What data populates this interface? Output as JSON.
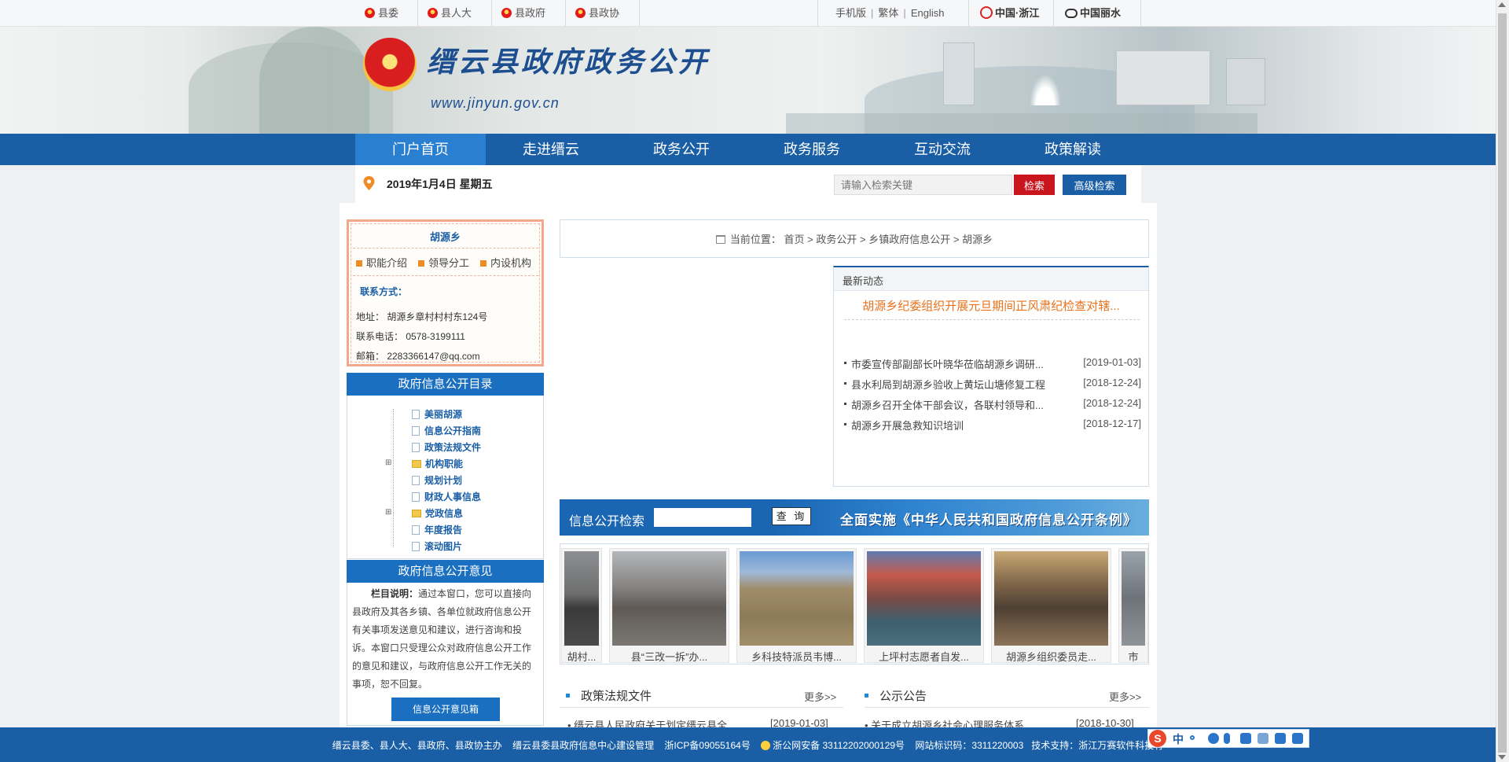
{
  "topbar": {
    "links": [
      "县委",
      "县人大",
      "县政府",
      "县政协"
    ],
    "right": [
      "手机版",
      "繁体",
      "English"
    ],
    "logos": [
      "中国·浙江",
      "中国丽水"
    ]
  },
  "banner": {
    "title": "缙云县政府政务公开",
    "url": "www.jinyun.gov.cn"
  },
  "nav": [
    "门户首页",
    "走进缙云",
    "政务公开",
    "政务服务",
    "互动交流",
    "政策解读"
  ],
  "subbar": {
    "date": "2019年1月4日 星期五",
    "search_placeholder": "请输入检索关键",
    "search_button": "检索",
    "advanced_button": "高级检索"
  },
  "town": {
    "name": "胡源乡",
    "links": [
      "职能介绍",
      "领导分工",
      "内设机构"
    ],
    "contact_title": "联系方式：",
    "address": "地址： 胡源乡章村村村东124号",
    "phone": "联系电话： 0578-3199111",
    "email": "邮箱： 2283366147@qq.com"
  },
  "catalog": {
    "title": "政府信息公开目录",
    "items": [
      {
        "label": "美丽胡源",
        "type": "doc"
      },
      {
        "label": "信息公开指南",
        "type": "doc"
      },
      {
        "label": "政策法规文件",
        "type": "doc"
      },
      {
        "label": "机构职能",
        "type": "folder"
      },
      {
        "label": "规划计划",
        "type": "doc"
      },
      {
        "label": "财政人事信息",
        "type": "doc"
      },
      {
        "label": "党政信息",
        "type": "folder"
      },
      {
        "label": "年度报告",
        "type": "doc"
      },
      {
        "label": "滚动图片",
        "type": "doc"
      }
    ]
  },
  "opinion": {
    "title": "政府信息公开意见",
    "lead": "栏目说明：",
    "text": "通过本窗口，您可以直接向县政府及其各乡镇、各单位就政府信息公开有关事项发送意见和建议，进行咨询和投诉。本窗口只受理公众对政府信息公开工作的意见和建议，与政府信息公开工作无关的事项，恕不回复。",
    "button": "信息公开意见箱"
  },
  "breadcrumb": {
    "label": "当前位置：",
    "path": [
      "首页",
      "政务公开",
      "乡镇政府信息公开",
      "胡源乡"
    ],
    "sep": ">"
  },
  "news": {
    "title": "最新动态",
    "headline": "胡源乡纪委组织开展元旦期间正风肃纪检查对辖...",
    "items": [
      {
        "title": "市委宣传部副部长叶晓华莅临胡源乡调研...",
        "date": "[2019-01-03]"
      },
      {
        "title": "县水利局到胡源乡验收上黄坛山塘修复工程",
        "date": "[2018-12-24]"
      },
      {
        "title": "胡源乡召开全体干部会议，各联村领导和...",
        "date": "[2018-12-24]"
      },
      {
        "title": "胡源乡开展急救知识培训",
        "date": "[2018-12-17]"
      }
    ]
  },
  "info_search": {
    "label": "信息公开检索",
    "button": "查 询",
    "slogan": "全面实施《中华人民共和国政府信息公开条例》"
  },
  "photos": [
    {
      "caption": "胡村..."
    },
    {
      "caption": "县“三改一拆”办..."
    },
    {
      "caption": "乡科技特派员韦博..."
    },
    {
      "caption": "上坪村志愿者自发..."
    },
    {
      "caption": "胡源乡组织委员走..."
    },
    {
      "caption": "市"
    }
  ],
  "columns": [
    {
      "title": "政策法规文件",
      "more": "更多>>",
      "row": {
        "title": "• 缙云县人民政府关于划定缙云县全...",
        "date": "[2019-01-03]"
      }
    },
    {
      "title": "公示公告",
      "more": "更多>>",
      "row": {
        "title": "• 关于成立胡源乡社会心理服务体系...",
        "date": "[2018-10-30]"
      }
    }
  ],
  "footer": {
    "text1": "缙云县委、县人大、县政府、县政协主办",
    "text2": "缙云县委县政府信息中心建设管理",
    "icp": "浙ICP备09055164号",
    "police": "浙公网安备 33112202000129号",
    "site_code": "网站标识码：3311220003",
    "support": "技术支持：浙江万赛软件科技有"
  },
  "ime": {
    "logo": "S",
    "mode": "中"
  }
}
